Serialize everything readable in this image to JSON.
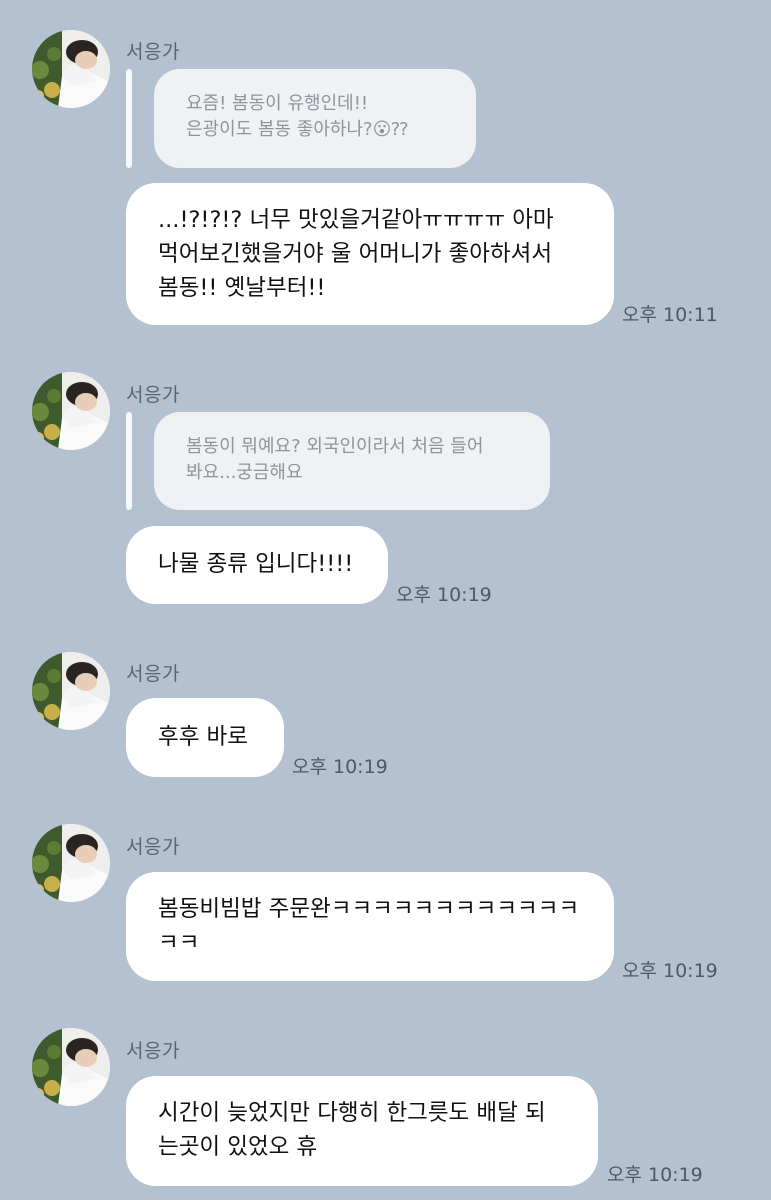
{
  "messages": [
    {
      "sender": "서응가",
      "quote": "요즘! 봄동이 유행인데!!\n은광이도 봄동 좋아하나?😮⁇",
      "text": "...!?!?!? 너무 맛있을거같아ㅠㅠㅠㅠ 아마\n먹어보긴했을거야 울 어머니가 좋아하셔서\n봄동!! 옛날부터!!",
      "time": "오후 10:11"
    },
    {
      "sender": "서응가",
      "quote": "봄동이 뭐예요? 외국인이라서 처음 들어\n봐요...궁금해요",
      "text": "나물 종류 입니다!!!!",
      "time": "오후 10:19"
    },
    {
      "sender": "서응가",
      "text": "후후 바로",
      "time": "오후 10:19"
    },
    {
      "sender": "서응가",
      "text": "봄동비빔밥 주문완ㅋㅋㅋㅋㅋㅋㅋㅋㅋㅋㅋㅋ\nㅋㅋ",
      "time": "오후 10:19"
    },
    {
      "sender": "서응가",
      "text": "시간이 늦었지만 다행히 한그릇도 배달 되\n는곳이 있었오 휴",
      "time": "오후 10:19"
    }
  ],
  "icons": {
    "avatar": "profile-photo"
  },
  "colors": {
    "background": "#b4c1d0",
    "bubble": "#ffffff",
    "quote_bubble": "#eff1f3",
    "quote_bar": "#f7f8fa",
    "text": "#111111",
    "quote_text": "#8e959d",
    "time": "#4f5964"
  }
}
